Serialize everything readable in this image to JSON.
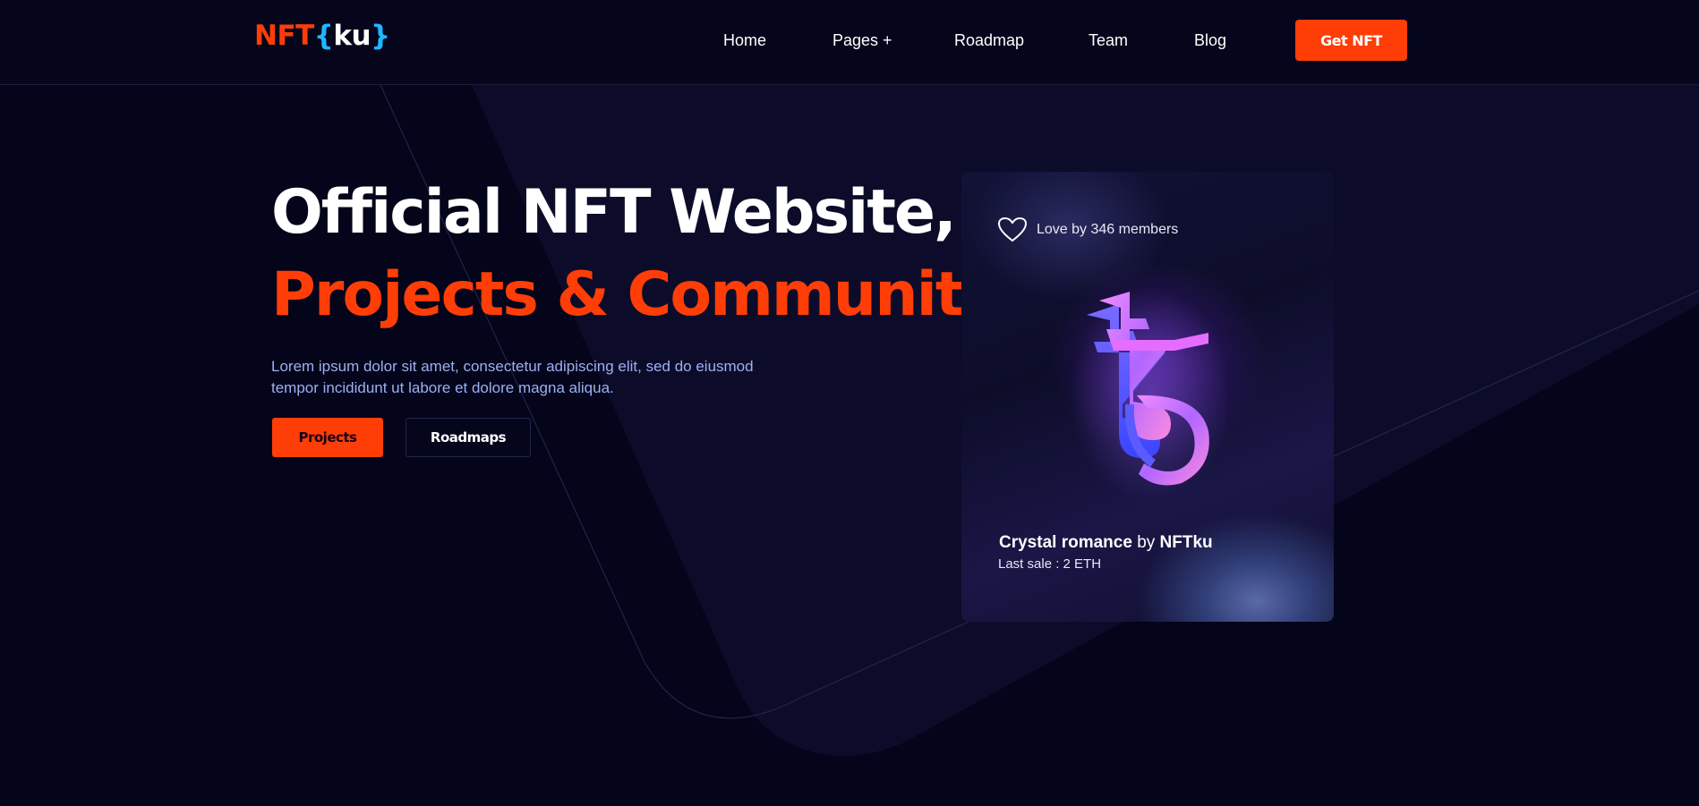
{
  "header": {
    "logo": {
      "part1": "NFT",
      "brace_open": "{",
      "part2": "ku",
      "brace_close": "}"
    },
    "nav": [
      "Home",
      "Pages +",
      "Roadmap",
      "Team",
      "Blog"
    ],
    "cta_label": "Get NFT"
  },
  "hero": {
    "title_line1": "Official NFT Website,",
    "title_line2": "Projects & Community",
    "description": "Lorem ipsum dolor sit amet, consectetur adipiscing elit, sed do eiusmod tempor incididunt ut labore et dolore magna aliqua.",
    "primary_button": "Projects",
    "secondary_button": "Roadmaps"
  },
  "card": {
    "love_text": "Love by 346 members",
    "title": "Crystal romance",
    "by_word": "by",
    "author": "NFTku",
    "last_sale": "Last sale : 2 ETH",
    "icon": "tezos-crystal-image"
  },
  "colors": {
    "accent": "#ff3d06",
    "logo_blue": "#1fb6ff",
    "background": "#04041a",
    "description_text": "#9bb0f2"
  }
}
